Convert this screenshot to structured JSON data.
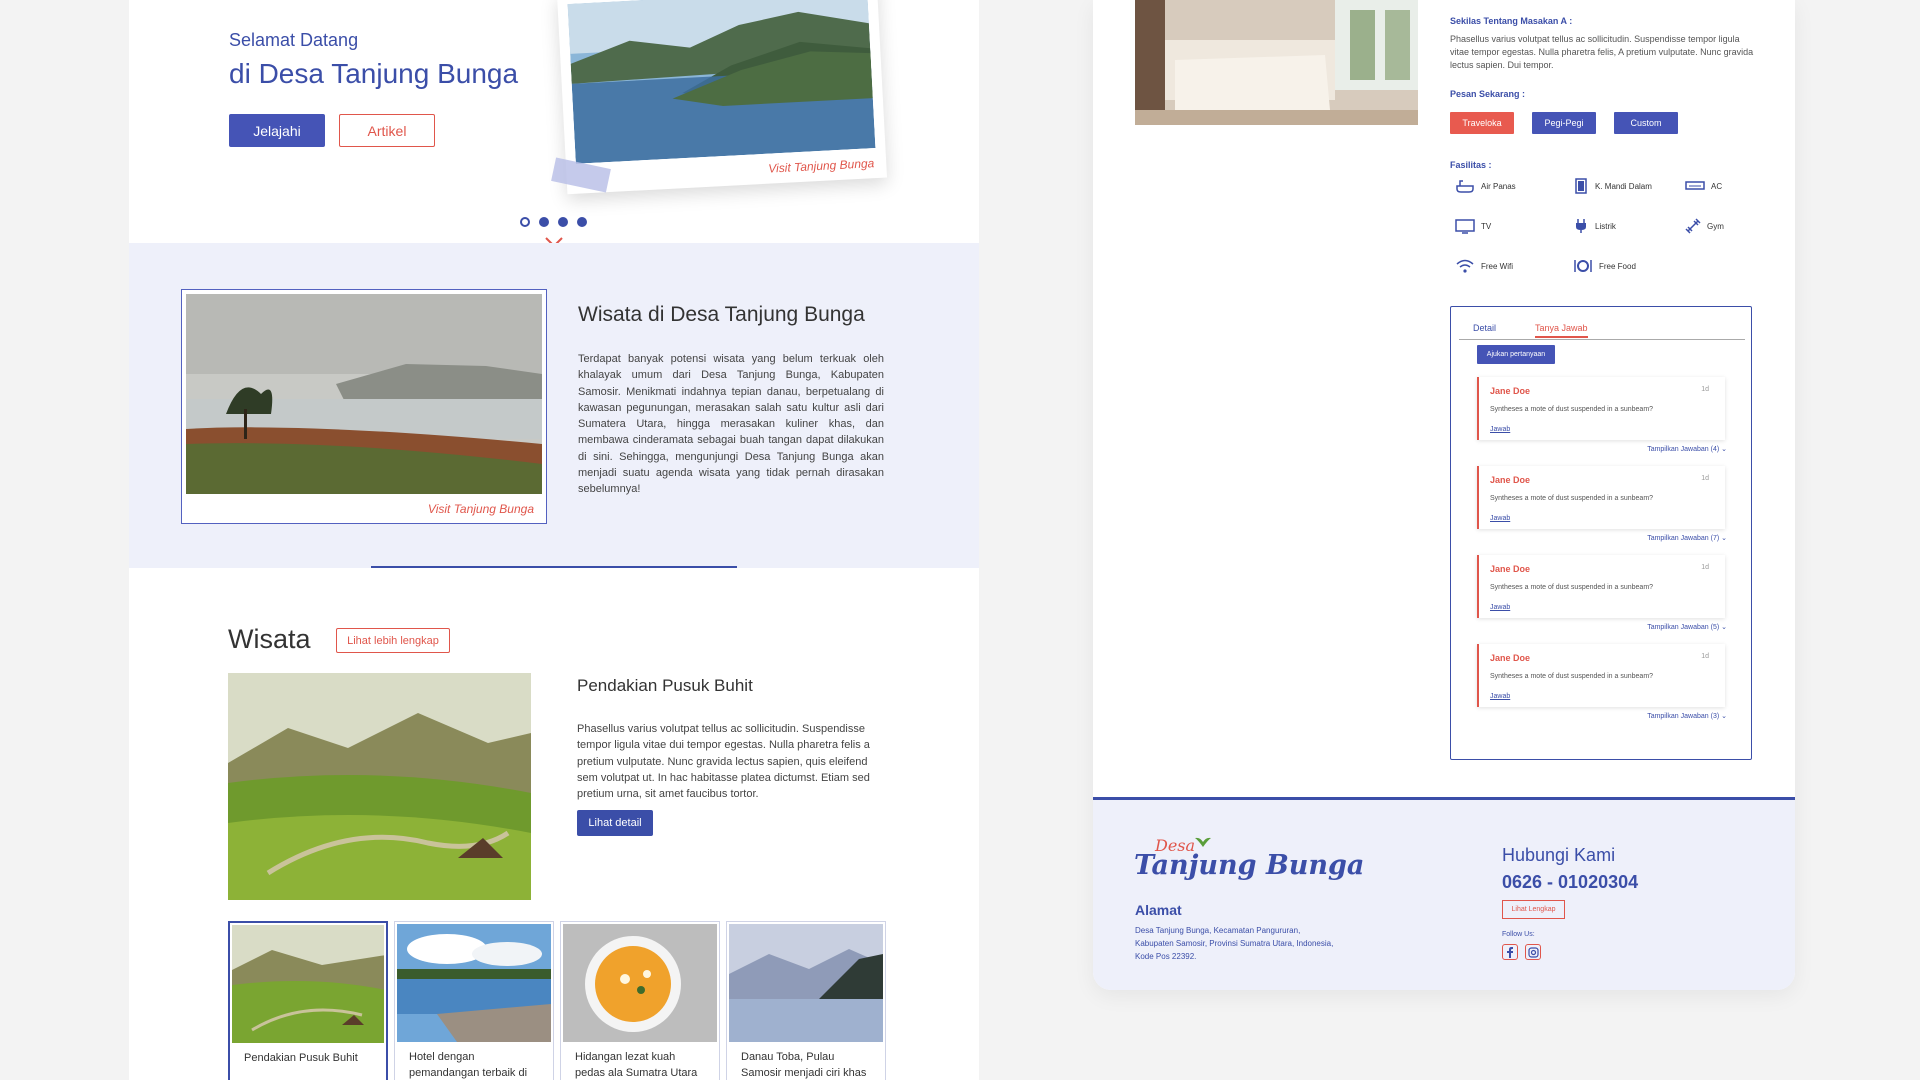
{
  "hero": {
    "greeting": "Selamat Datang",
    "title": "di Desa Tanjung Bunga",
    "explore_label": "Jelajahi",
    "article_label": "Artikel",
    "photo_caption": "Visit Tanjung Bunga",
    "carousel_active_index": 1,
    "carousel_count": 4
  },
  "intro": {
    "photo_caption": "Visit Tanjung Bunga",
    "title": "Wisata di Desa Tanjung Bunga",
    "body": "Terdapat banyak potensi wisata yang belum terkuak oleh khalayak umum dari Desa Tanjung Bunga, Kabupaten Samosir. Menikmati indahnya tepian danau, berpetualang di kawasan pegunungan, merasakan salah satu kultur asli dari Sumatera Utara, hingga merasakan kuliner khas, dan membawa cinderamata sebagai buah tangan dapat dilakukan di sini. Sehingga, mengunjungi Desa Tanjung Bunga akan menjadi suatu agenda wisata yang tidak pernah dirasakan sebelumnya!"
  },
  "wisata": {
    "title": "Wisata",
    "more_label": "Lihat lebih lengkap",
    "featured_title": "Pendakian Pusuk Buhit",
    "featured_body": "Phasellus varius volutpat tellus ac sollicitudin. Suspendisse tempor ligula vitae dui tempor egestas. Nulla pharetra felis a pretium vulputate. Nunc gravida lectus sapien, quis eleifend sem volutpat ut. In hac habitasse platea dictumst. Etiam sed pretium urna, sit amet faucibus tortor.",
    "detail_label": "Lihat detail",
    "thumbs": [
      {
        "caption": "Pendakian Pusuk Buhit"
      },
      {
        "caption": "Hotel dengan pemandangan terbaik di"
      },
      {
        "caption": "Hidangan lezat kuah pedas ala Sumatra Utara"
      },
      {
        "caption": "Danau Toba, Pulau Samosir menjadi ciri khas"
      }
    ]
  },
  "detail": {
    "about_heading": "Sekilas Tentang Masakan A :",
    "about_body": "Phasellus varius volutpat tellus ac sollicitudin. Suspendisse tempor ligula vitae tempor egestas. Nulla pharetra felis, A pretium vulputate. Nunc gravida lectus sapien. Dui tempor.",
    "order_heading": "Pesan Sekarang :",
    "order_buttons": [
      {
        "label": "Traveloka",
        "color": "#e85a4f"
      },
      {
        "label": "Pegi-Pegi",
        "color": "#4554b6"
      },
      {
        "label": "Custom",
        "color": "#4554b6"
      }
    ],
    "facilities_heading": "Fasilitas :",
    "facilities": [
      {
        "label": "Air Panas",
        "icon": "bathtub-icon"
      },
      {
        "label": "K. Mandi Dalam",
        "icon": "door-icon"
      },
      {
        "label": "AC",
        "icon": "air-conditioner-icon"
      },
      {
        "label": "TV",
        "icon": "tv-icon"
      },
      {
        "label": "Listrik",
        "icon": "plug-icon"
      },
      {
        "label": "Gym",
        "icon": "dumbbell-icon"
      },
      {
        "label": "Free Wifi",
        "icon": "wifi-icon"
      },
      {
        "label": "Free Food",
        "icon": "dining-icon"
      }
    ]
  },
  "qa": {
    "tabs": [
      "Detail",
      "Tanya Jawab"
    ],
    "active_tab": "Tanya Jawab",
    "ask_label": "Ajukan pertanyaan",
    "items": [
      {
        "name": "Jane Doe",
        "time": "1d",
        "question": "Syntheses a mote of dust suspended in a sunbeam?",
        "reply": "Jawab",
        "toggle": "Tampilkan Jawaban (4)"
      },
      {
        "name": "Jane Doe",
        "time": "1d",
        "question": "Syntheses a mote of dust suspended in a sunbeam?",
        "reply": "Jawab",
        "toggle": "Tampilkan Jawaban (7)"
      },
      {
        "name": "Jane Doe",
        "time": "1d",
        "question": "Syntheses a mote of dust suspended in a sunbeam?",
        "reply": "Jawab",
        "toggle": "Tampilkan Jawaban (5)"
      },
      {
        "name": "Jane Doe",
        "time": "1d",
        "question": "Syntheses a mote of dust suspended in a sunbeam?",
        "reply": "Jawab",
        "toggle": "Tampilkan Jawaban (3)"
      }
    ]
  },
  "footer": {
    "logo_top": "Desa",
    "logo_main": "Tanjung Bunga",
    "address_heading": "Alamat",
    "address": "Desa Tanjung Bunga, Kecamatan Pangururan, Kabupaten Samosir, Provinsi Sumatra Utara, Indonesia, Kode Pos 22392.",
    "contact_heading": "Hubungi Kami",
    "phone": "0626 - 01020304",
    "contact_more_label": "Lihat Lengkap",
    "follow_label": "Follow Us:",
    "socials": [
      "facebook-icon",
      "instagram-icon"
    ]
  },
  "colors": {
    "primary": "#3b4ea8",
    "accent": "#e0564b",
    "section_bg": "#eef0fa"
  }
}
